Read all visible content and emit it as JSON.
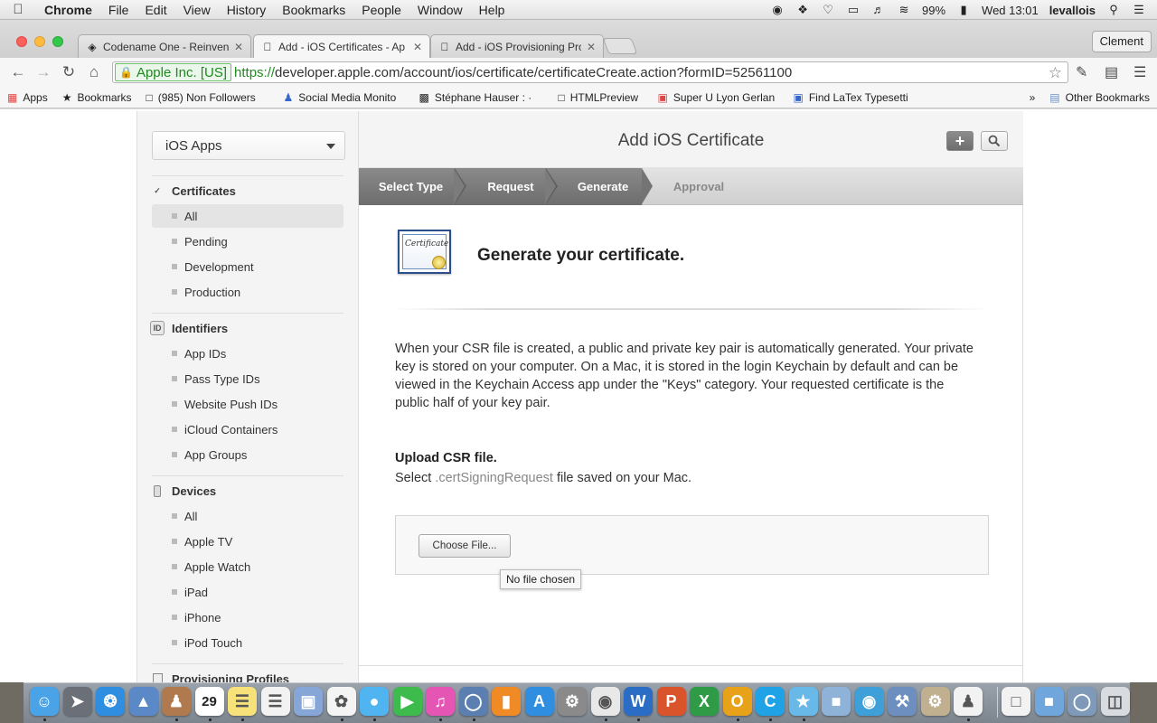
{
  "menubar": {
    "items": [
      "Chrome",
      "File",
      "Edit",
      "View",
      "History",
      "Bookmarks",
      "People",
      "Window",
      "Help"
    ],
    "battery": "99%",
    "clock": "Wed 13:01",
    "user": "levallois"
  },
  "tabs": [
    {
      "title": "Codename One - Reinvent",
      "icon": "codenameone-icon"
    },
    {
      "title": "Add - iOS Certificates - Ap",
      "icon": "apple-icon"
    },
    {
      "title": "Add - iOS Provisioning Pro",
      "icon": "apple-icon"
    }
  ],
  "profile": "Clement",
  "address": {
    "ev_label": "Apple Inc. [US]",
    "scheme": "https://",
    "rest": "developer.apple.com/account/ios/certificate/certificateCreate.action?formID=52561100"
  },
  "bookmarks": [
    {
      "label": "Apps",
      "icon": "apps-grid-icon"
    },
    {
      "label": "Bookmarks",
      "icon": "star-icon"
    },
    {
      "label": "(985) Non Followers",
      "icon": "page-icon"
    },
    {
      "label": "Social Media Monito",
      "icon": "social-icon"
    },
    {
      "label": "Stéphane Hauser : ·",
      "icon": "news-icon"
    },
    {
      "label": "HTMLPreview",
      "icon": "page-icon"
    },
    {
      "label": "Super U Lyon Gerlan",
      "icon": "store-icon"
    },
    {
      "label": "Find LaTex Typesetti",
      "icon": "latex-icon"
    }
  ],
  "other_bookmarks": "Other Bookmarks",
  "sidebar": {
    "app_select": "iOS Apps",
    "sections": [
      {
        "title": "Certificates",
        "items": [
          "All",
          "Pending",
          "Development",
          "Production"
        ]
      },
      {
        "title": "Identifiers",
        "items": [
          "App IDs",
          "Pass Type IDs",
          "Website Push IDs",
          "iCloud Containers",
          "App Groups"
        ]
      },
      {
        "title": "Devices",
        "items": [
          "All",
          "Apple TV",
          "Apple Watch",
          "iPad",
          "iPhone",
          "iPod Touch"
        ]
      },
      {
        "title": "Provisioning Profiles",
        "items": []
      }
    ]
  },
  "main": {
    "title": "Add iOS Certificate",
    "steps": [
      "Select Type",
      "Request",
      "Generate",
      "Approval"
    ],
    "cert_icon_text": "Certificate",
    "heading": "Generate your certificate.",
    "description": "When your CSR file is created, a public and private key pair is automatically generated. Your private key is stored on your computer. On a Mac, it is stored in the login Keychain by default and can be viewed in the Keychain Access app under the \"Keys\" category. Your requested certificate is the public half of your key pair.",
    "upload_heading": "Upload CSR file.",
    "upload_prefix": "Select ",
    "upload_ext": ".certSigningRequest",
    "upload_suffix": " file saved on your Mac.",
    "choose_file": "Choose File...",
    "no_file": "No file chosen"
  },
  "dock": {
    "calendar_day": "29",
    "icons": [
      "finder-icon",
      "launchpad-icon",
      "safari-icon",
      "preview-icon",
      "contacts-icon",
      "calendar-icon",
      "notes-icon",
      "reminders-icon",
      "photos-browser-icon",
      "photos-icon",
      "messages-icon",
      "facetime-icon",
      "itunes-icon",
      "quicktime-icon",
      "ibooks-icon",
      "appstore-icon",
      "systemprefs-icon",
      "chrome-icon",
      "word-icon",
      "powerpoint-icon",
      "excel-icon",
      "outlook-icon",
      "skype-icon",
      "folder-app-icon",
      "virtualbox-icon",
      "globe-app-icon",
      "xcode-icon",
      "tool-icon",
      "butler-icon",
      "document-icon",
      "box-icon",
      "circle-app-icon",
      "trash-icon"
    ]
  }
}
